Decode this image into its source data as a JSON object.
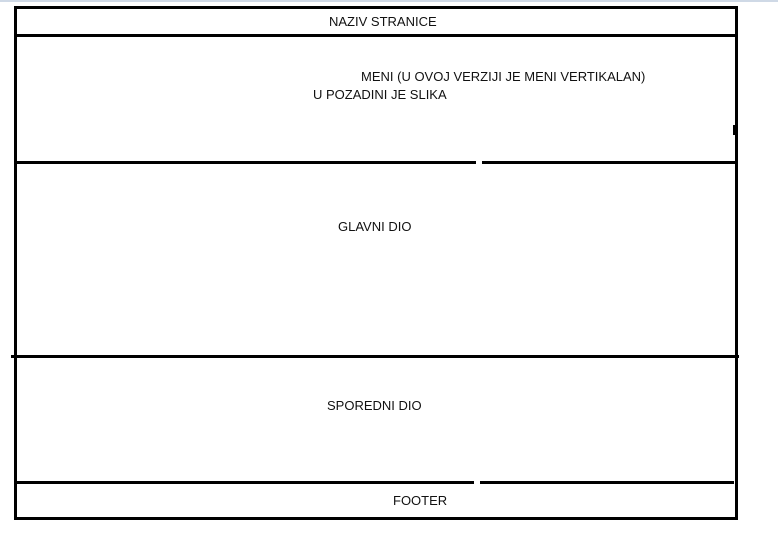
{
  "sections": {
    "header": "NAZIV STRANICE",
    "menu_line1": "MENI (U OVOJ VERZIJI JE MENI VERTIKALAN)",
    "menu_line2": "U POZADINI JE SLIKA",
    "main": "GLAVNI DIO",
    "secondary": "SPOREDNI DIO",
    "footer": "FOOTER"
  },
  "colors": {
    "line": "#000000",
    "background": "#ffffff",
    "top_strip": "#cfd9e6"
  }
}
